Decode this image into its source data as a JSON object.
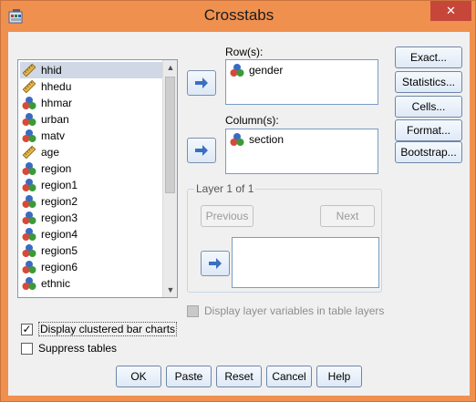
{
  "window": {
    "title": "Crosstabs",
    "close_glyph": "✕"
  },
  "variables": [
    {
      "label": "hhid",
      "type": "scale",
      "selected": true
    },
    {
      "label": "hhedu",
      "type": "scale"
    },
    {
      "label": "hhmar",
      "type": "nominal"
    },
    {
      "label": "urban",
      "type": "nominal"
    },
    {
      "label": "matv",
      "type": "nominal"
    },
    {
      "label": "age",
      "type": "scale"
    },
    {
      "label": "region",
      "type": "nominal"
    },
    {
      "label": "region1",
      "type": "nominal"
    },
    {
      "label": "region2",
      "type": "nominal"
    },
    {
      "label": "region3",
      "type": "nominal"
    },
    {
      "label": "region4",
      "type": "nominal"
    },
    {
      "label": "region5",
      "type": "nominal"
    },
    {
      "label": "region6",
      "type": "nominal"
    },
    {
      "label": "ethnic",
      "type": "nominal"
    }
  ],
  "scroll": {
    "up_glyph": "▲",
    "down_glyph": "▼"
  },
  "rows": {
    "label": "Row(s):",
    "items": [
      "gender"
    ]
  },
  "columns": {
    "label": "Column(s):",
    "items": [
      "section"
    ]
  },
  "layer": {
    "legend": "Layer 1 of 1",
    "previous_label": "Previous",
    "next_label": "Next"
  },
  "side_buttons": {
    "exact": "Exact...",
    "statistics": "Statistics...",
    "cells": "Cells...",
    "format": "Format...",
    "bootstrap": "Bootstrap..."
  },
  "options": {
    "display_layer_vars": {
      "label": "Display layer variables in table layers",
      "checked": false,
      "enabled": false
    },
    "clustered_bar": {
      "label": "Display clustered bar charts",
      "checked": true
    },
    "suppress_tables": {
      "label": "Suppress tables",
      "checked": false
    }
  },
  "bottom_buttons": {
    "ok": "OK",
    "paste": "Paste",
    "reset": "Reset",
    "cancel": "Cancel",
    "help": "Help"
  },
  "colors": {
    "title_bar": "#f0904f",
    "close_button": "#c7463a",
    "arrow_fill": "#3b6fc1",
    "var_red": "#d64a3a",
    "var_green": "#3a9a3a",
    "var_blue": "#3a6bc4",
    "ruler": "#e6b84a"
  }
}
